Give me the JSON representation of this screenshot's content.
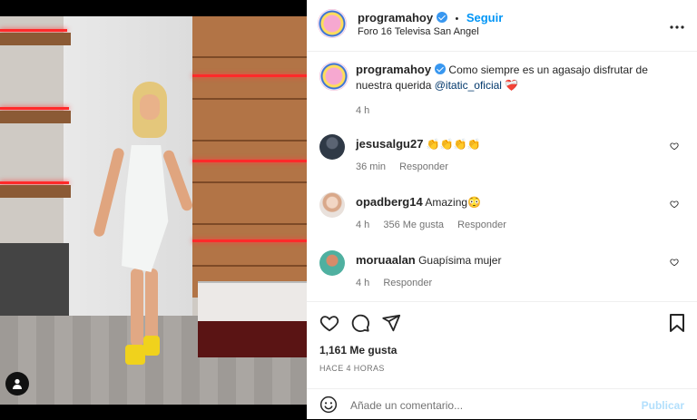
{
  "header": {
    "username": "programahoy",
    "dot": "•",
    "follow_label": "Seguir",
    "location": "Foro 16 Televisa San Angel",
    "menu": "•••"
  },
  "caption": {
    "username": "programahoy",
    "text": "Como siempre es un agasajo disfrutar de nuestra querida",
    "mention": "@itatic_oficial",
    "emoji": "❤️‍🩹",
    "time": "4 h"
  },
  "comments": [
    {
      "username": "jesusalgu27",
      "text": "👏👏👏👏",
      "time": "36 min",
      "likes": "",
      "reply": "Responder"
    },
    {
      "username": "opadberg14",
      "text": "Amazing😳",
      "time": "4 h",
      "likes": "356 Me gusta",
      "reply": "Responder"
    },
    {
      "username": "moruaalan",
      "text": "Guapísima mujer",
      "time": "4 h",
      "likes": "",
      "reply": "Responder"
    }
  ],
  "stats": {
    "likes": "1,161 Me gusta",
    "posted": "HACE 4 HORAS"
  },
  "compose": {
    "placeholder": "Añade un comentario...",
    "publish": "Publicar"
  },
  "colors": {
    "accent": "#0095f6",
    "verified": "#3897f0",
    "muted": "#737373",
    "publish_disabled": "#b2dffc"
  }
}
